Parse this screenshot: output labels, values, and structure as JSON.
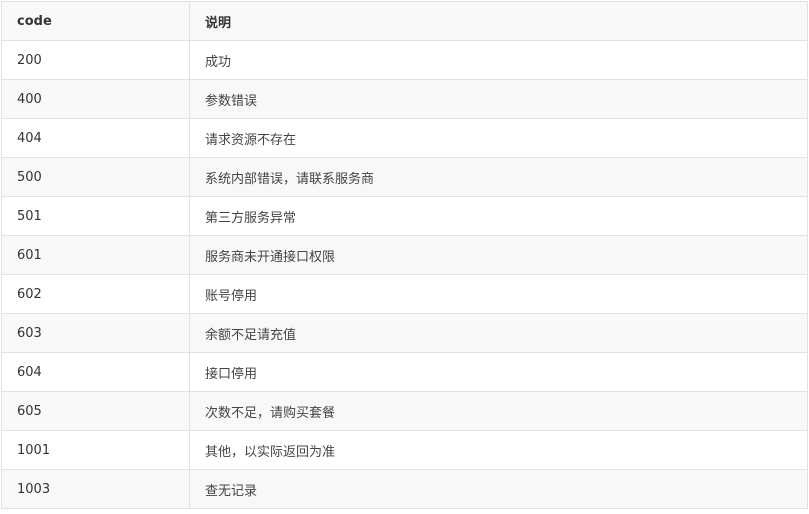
{
  "table": {
    "headers": [
      "code",
      "说明"
    ],
    "rows": [
      {
        "code": "200",
        "desc": "成功"
      },
      {
        "code": "400",
        "desc": "参数错误"
      },
      {
        "code": "404",
        "desc": "请求资源不存在"
      },
      {
        "code": "500",
        "desc": "系统内部错误，请联系服务商"
      },
      {
        "code": "501",
        "desc": "第三方服务异常"
      },
      {
        "code": "601",
        "desc": "服务商未开通接口权限"
      },
      {
        "code": "602",
        "desc": "账号停用"
      },
      {
        "code": "603",
        "desc": "余额不足请充值"
      },
      {
        "code": "604",
        "desc": "接口停用"
      },
      {
        "code": "605",
        "desc": "次数不足，请购买套餐"
      },
      {
        "code": "1001",
        "desc": "其他，以实际返回为准"
      },
      {
        "code": "1003",
        "desc": "查无记录"
      }
    ]
  },
  "colors": {
    "border": "#dfe2e5",
    "header_bg": "#f8f8f8",
    "stripe_bg": "#f8f8f8",
    "row_bg": "#ffffff",
    "text": "#333333"
  }
}
